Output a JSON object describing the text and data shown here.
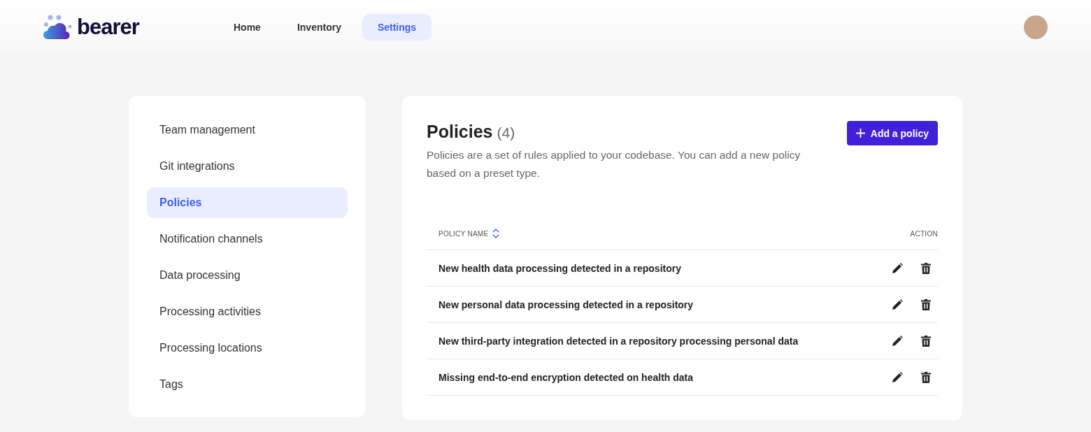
{
  "header": {
    "logo_text": "bearer",
    "nav": [
      {
        "label": "Home",
        "selected": false
      },
      {
        "label": "Inventory",
        "selected": false
      },
      {
        "label": "Settings",
        "selected": true
      }
    ]
  },
  "sidebar": {
    "items": [
      {
        "label": "Team management",
        "selected": false
      },
      {
        "label": "Git integrations",
        "selected": false
      },
      {
        "label": "Policies",
        "selected": true
      },
      {
        "label": "Notification channels",
        "selected": false
      },
      {
        "label": "Data processing",
        "selected": false
      },
      {
        "label": "Processing activities",
        "selected": false
      },
      {
        "label": "Processing locations",
        "selected": false
      },
      {
        "label": "Tags",
        "selected": false
      }
    ]
  },
  "policies": {
    "title": "Policies",
    "count": "(4)",
    "description": "Policies are a set of rules applied to your codebase. You can add a new policy based on a preset type.",
    "add_button": "Add a policy",
    "columns": [
      "POLICY NAME",
      "ACTION"
    ],
    "rows": [
      {
        "name": "New health data processing detected in a repository"
      },
      {
        "name": "New personal data processing detected in a repository"
      },
      {
        "name": "New third-party integration detected in a repository processing personal data"
      },
      {
        "name": "Missing end-to-end encryption detected on health data"
      }
    ]
  }
}
